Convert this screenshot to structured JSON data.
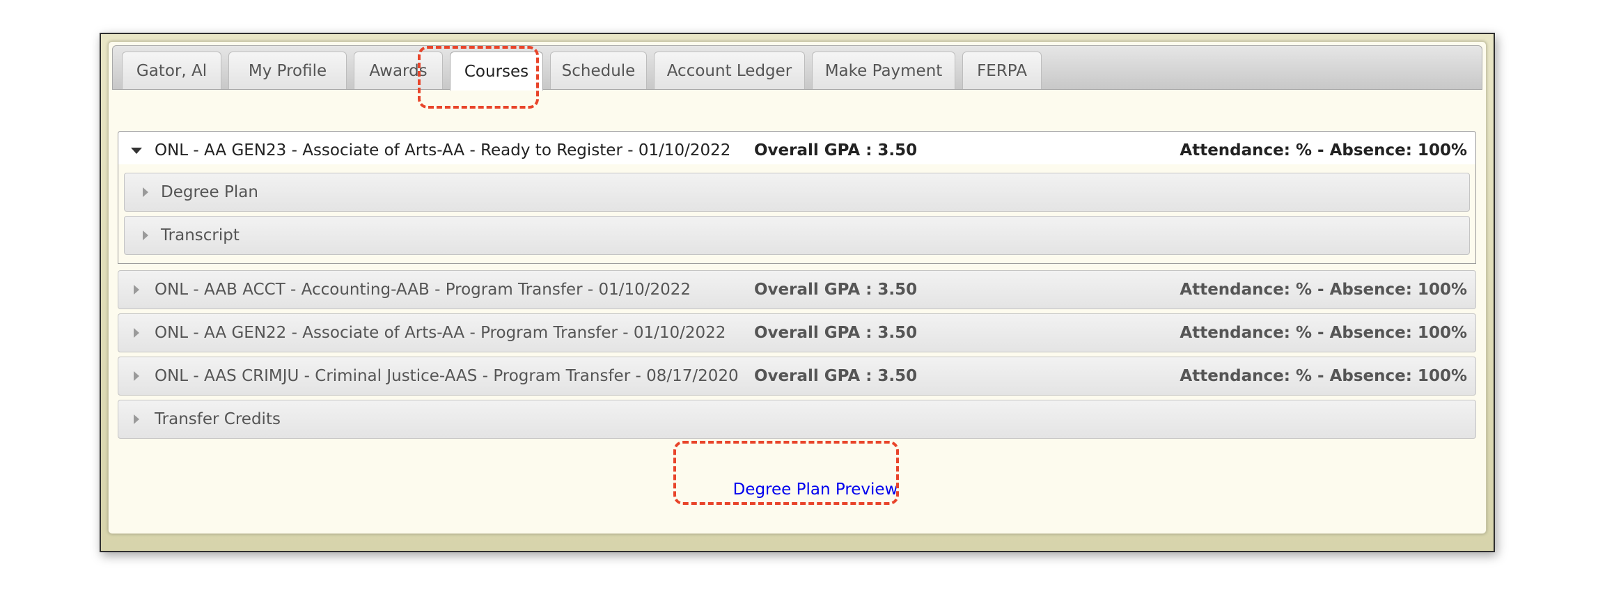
{
  "tabs": [
    {
      "label": "Gator, Al"
    },
    {
      "label": "My Profile"
    },
    {
      "label": "Awards"
    },
    {
      "label": "Courses"
    },
    {
      "label": "Schedule"
    },
    {
      "label": "Account Ledger"
    },
    {
      "label": "Make Payment"
    },
    {
      "label": "FERPA"
    }
  ],
  "active_tab": "Courses",
  "programs": [
    {
      "label": "ONL - AA GEN23 - Associate of Arts-AA - Ready to Register - 01/10/2022",
      "gpa": "Overall GPA : 3.50",
      "attendance": "Attendance: % - Absence: 100%",
      "expanded": true
    },
    {
      "label": "ONL - AAB ACCT - Accounting-AAB - Program Transfer - 01/10/2022",
      "gpa": "Overall GPA : 3.50",
      "attendance": "Attendance: % - Absence: 100%",
      "expanded": false
    },
    {
      "label": "ONL - AA GEN22 - Associate of Arts-AA - Program Transfer - 01/10/2022",
      "gpa": "Overall GPA : 3.50",
      "attendance": "Attendance: % - Absence: 100%",
      "expanded": false
    },
    {
      "label": "ONL - AAS CRIMJU - Criminal Justice-AAS - Program Transfer - 08/17/2020",
      "gpa": "Overall GPA : 3.50",
      "attendance": "Attendance: % - Absence: 100%",
      "expanded": false
    }
  ],
  "sub_sections": [
    {
      "label": "Degree Plan"
    },
    {
      "label": "Transcript"
    }
  ],
  "transfer_credits": {
    "label": "Transfer Credits"
  },
  "degree_plan_preview": {
    "label": "Degree Plan Preview"
  },
  "colors": {
    "highlight": "#e8442a",
    "link": "#0000ee",
    "panel_bg": "#fdfbee",
    "frame_bg": "#e9e6c6"
  }
}
